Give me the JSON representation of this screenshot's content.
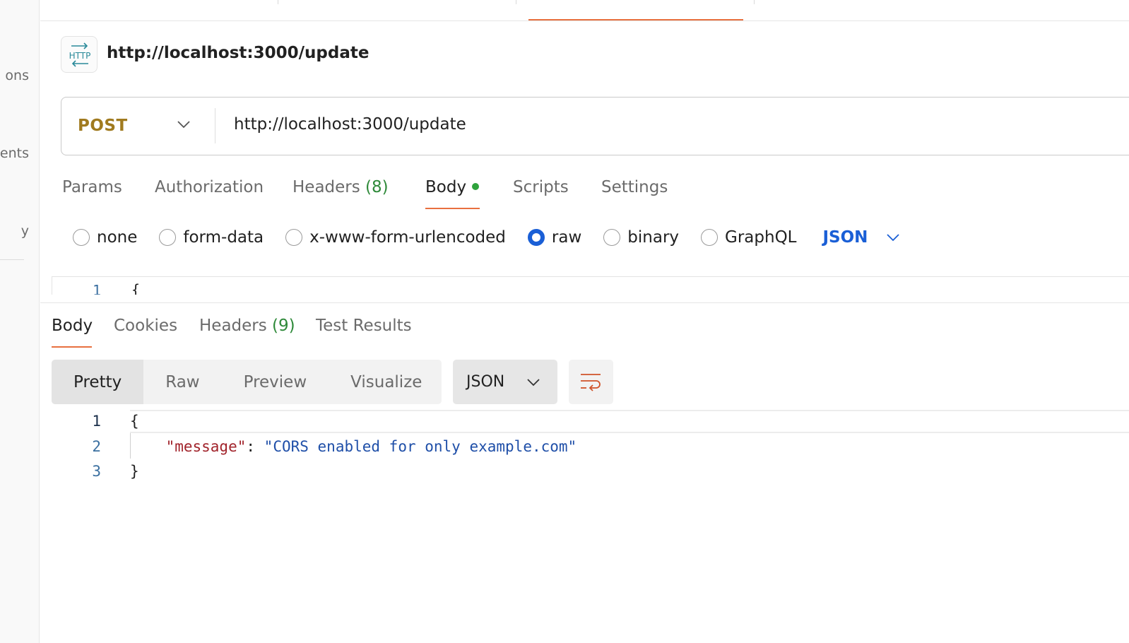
{
  "sidebar": {
    "items": [
      {
        "label": "ons"
      },
      {
        "label": "ents"
      },
      {
        "label": "y"
      }
    ]
  },
  "request": {
    "title": "http://localhost:3000/update",
    "method": "POST",
    "url": "http://localhost:3000/update",
    "tabs": [
      {
        "label": "Params"
      },
      {
        "label": "Authorization"
      },
      {
        "label": "Headers",
        "count": "(8)"
      },
      {
        "label": "Body",
        "active": true
      },
      {
        "label": "Scripts"
      },
      {
        "label": "Settings"
      }
    ],
    "body_types": [
      {
        "label": "none",
        "checked": false
      },
      {
        "label": "form-data",
        "checked": false
      },
      {
        "label": "x-www-form-urlencoded",
        "checked": false
      },
      {
        "label": "raw",
        "checked": true
      },
      {
        "label": "binary",
        "checked": false
      },
      {
        "label": "GraphQL",
        "checked": false
      }
    ],
    "raw_format": "JSON",
    "editor": {
      "line_number": "1",
      "first_line": "{"
    }
  },
  "response": {
    "tabs": [
      {
        "label": "Body",
        "active": true
      },
      {
        "label": "Cookies"
      },
      {
        "label": "Headers",
        "count": "(9)"
      },
      {
        "label": "Test Results"
      }
    ],
    "view_modes": [
      {
        "label": "Pretty",
        "active": true
      },
      {
        "label": "Raw"
      },
      {
        "label": "Preview"
      },
      {
        "label": "Visualize"
      }
    ],
    "format": "JSON",
    "code": {
      "line_numbers": [
        "1",
        "2",
        "3"
      ],
      "open_brace": "{",
      "key": "\"message\"",
      "colon": ": ",
      "value": "\"CORS enabled for only example.com\"",
      "close_brace": "}"
    }
  },
  "icons": {
    "http_icon": "http-request-icon",
    "method_chevron": "chevron-down-icon",
    "format_chevron": "chevron-down-icon",
    "wrap": "word-wrap-icon"
  },
  "colors": {
    "accent": "#e8703f",
    "method": "#a07a1f",
    "link_blue": "#1a5fd6",
    "count_green": "#2f8a3a",
    "json_key": "#a1232b",
    "json_string": "#1f4fa8"
  }
}
